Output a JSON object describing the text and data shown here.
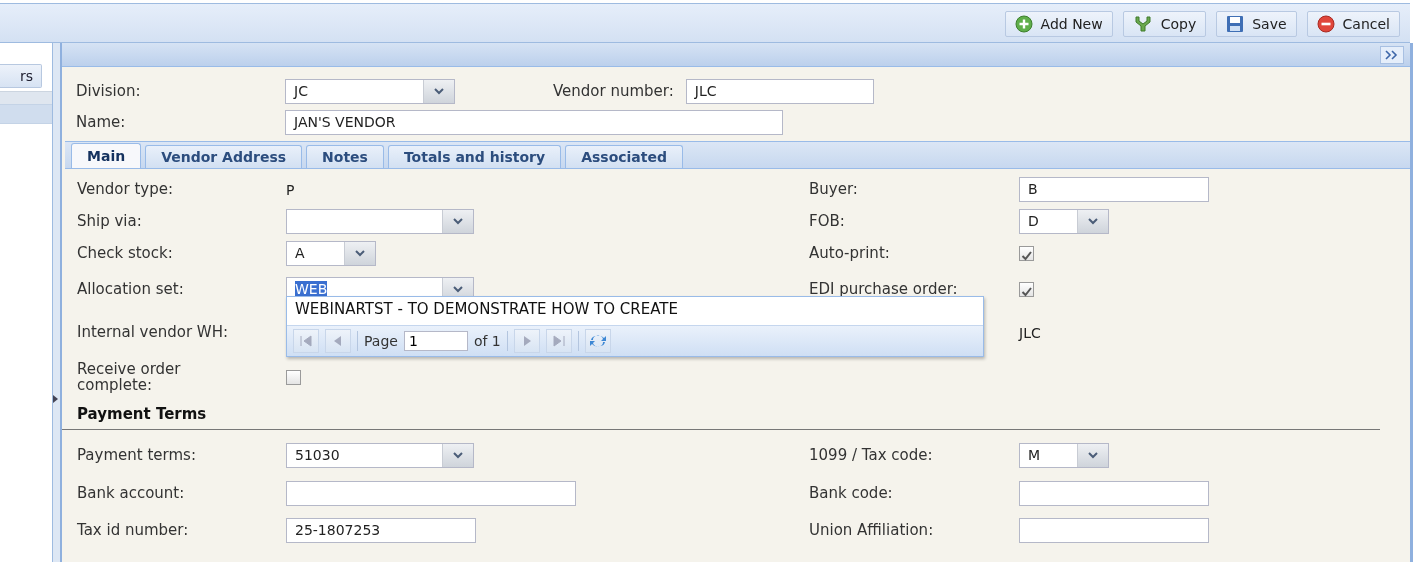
{
  "toolbar": {
    "buttons": [
      {
        "label": "Add New",
        "kind": "add"
      },
      {
        "label": "Copy",
        "kind": "copy"
      },
      {
        "label": "Save",
        "kind": "save"
      },
      {
        "label": "Cancel",
        "kind": "cancel"
      }
    ]
  },
  "side_tab": {
    "label": "rs"
  },
  "header_fields": [
    {
      "label": "Division:",
      "value": "JC",
      "kind": "combo"
    },
    {
      "label": "Vendor number:",
      "value": "JLC",
      "kind": "text"
    },
    {
      "label": "Name:",
      "value": "JAN'S VENDOR",
      "kind": "text"
    }
  ],
  "tabs": [
    {
      "label": "Main",
      "selected": true
    },
    {
      "label": "Vendor Address",
      "selected": false
    },
    {
      "label": "Notes",
      "selected": false
    },
    {
      "label": "Totals and history",
      "selected": false
    },
    {
      "label": "Associated",
      "selected": false
    }
  ],
  "main_rows": [
    {
      "left": {
        "label": "Vendor type:",
        "value": "P",
        "kind": "static"
      },
      "right": {
        "label": "Buyer:",
        "value": "B",
        "kind": "text"
      }
    },
    {
      "left": {
        "label": "Ship via:",
        "kind": "combo"
      },
      "right": {
        "label": "FOB:",
        "value": "D",
        "kind": "combo"
      }
    },
    {
      "left": {
        "label": "Check stock:",
        "value": "A",
        "kind": "combo"
      },
      "right": {
        "label": "Auto-print:",
        "kind": "checkbox",
        "checked": true
      }
    },
    {
      "left": {
        "label": "Allocation set:",
        "value": "WEB",
        "kind": "combo",
        "highlighted": true
      },
      "right": {
        "label": "EDI purchase order:",
        "kind": "checkbox",
        "checked": true
      }
    },
    {
      "left": {
        "label": "Internal vendor WH:",
        "kind": "hidden"
      },
      "right": {
        "value": "JLC",
        "kind": "static"
      }
    },
    {
      "left": {
        "label": "Receive order complete:",
        "kind": "checkbox",
        "checked": false
      }
    }
  ],
  "payment_section": {
    "title": "Payment Terms",
    "rows": [
      {
        "left": {
          "label": "Payment terms:",
          "value": "51030",
          "kind": "combo"
        },
        "right": {
          "label": "1099 / Tax code:",
          "value": "M",
          "kind": "combo"
        }
      },
      {
        "left": {
          "label": "Bank account:",
          "kind": "text"
        },
        "right": {
          "label": "Bank code:",
          "kind": "text"
        }
      },
      {
        "left": {
          "label": "Tax id number:",
          "value": "25-1807253",
          "kind": "text"
        },
        "right": {
          "label": "Union Affiliation:",
          "kind": "text"
        }
      }
    ]
  },
  "dropdown": {
    "items": [
      "WEBINARTST - TO DEMONSTRATE HOW TO CREATE"
    ],
    "pager": {
      "label": "Page",
      "page": "1",
      "of": "of 1",
      "nav": [
        {
          "kind": "first",
          "disabled": true
        },
        {
          "kind": "prev",
          "disabled": true
        },
        {
          "kind": "next",
          "disabled": true
        },
        {
          "kind": "last",
          "disabled": true
        }
      ]
    }
  }
}
